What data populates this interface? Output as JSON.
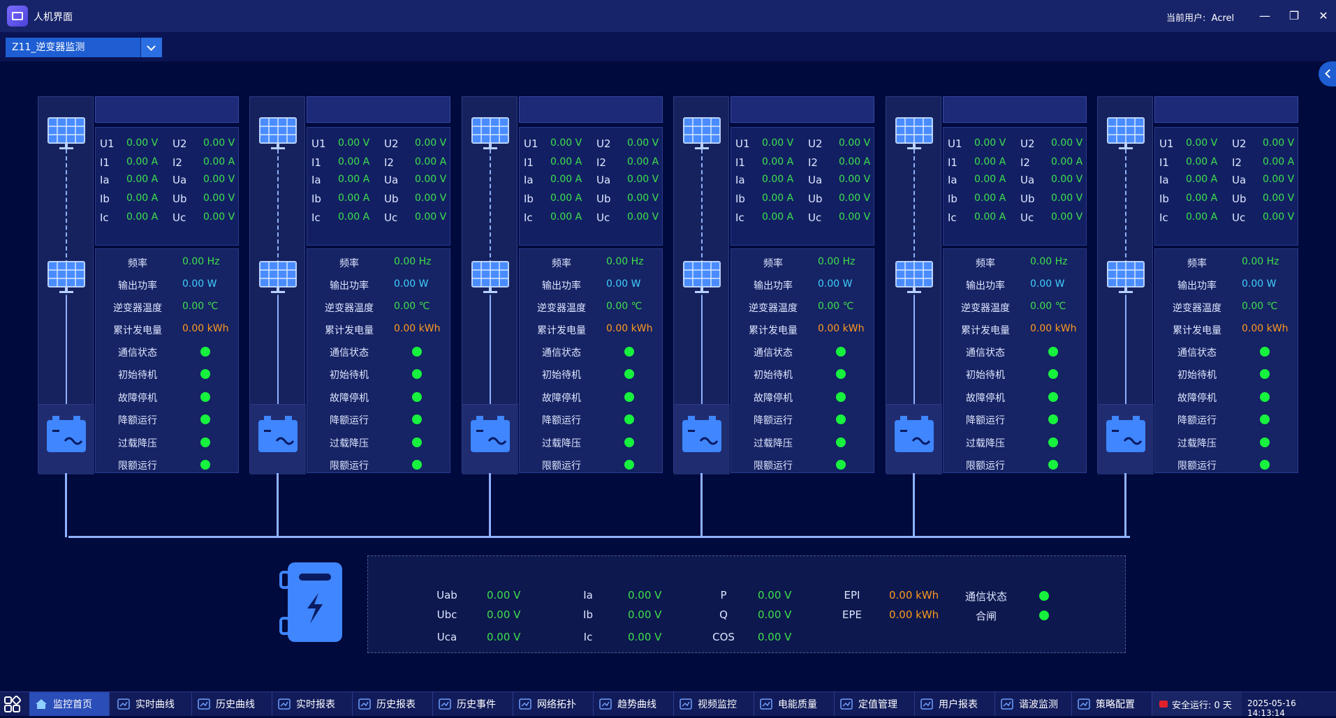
{
  "window": {
    "title": "人机界面",
    "user_label": "当前用户:",
    "user": "Acrel"
  },
  "selector": {
    "value": "Z11_逆变器监测"
  },
  "inverters": [
    {
      "U1": "0.00 V",
      "U2": "0.00 V",
      "I1": "0.00 A",
      "I2": "0.00 A",
      "Ia": "0.00 A",
      "Ua": "0.00 V",
      "Ib": "0.00 A",
      "Ub": "0.00 V",
      "Ic": "0.00 A",
      "Uc": "0.00 V",
      "freq": "0.00 Hz",
      "power": "0.00 W",
      "temp": "0.00 ℃",
      "energy": "0.00 kWh"
    },
    {
      "U1": "0.00 V",
      "U2": "0.00 V",
      "I1": "0.00 A",
      "I2": "0.00 A",
      "Ia": "0.00 A",
      "Ua": "0.00 V",
      "Ib": "0.00 A",
      "Ub": "0.00 V",
      "Ic": "0.00 A",
      "Uc": "0.00 V",
      "freq": "0.00 Hz",
      "power": "0.00 W",
      "temp": "0.00 ℃",
      "energy": "0.00 kWh"
    },
    {
      "U1": "0.00 V",
      "U2": "0.00 V",
      "I1": "0.00 A",
      "I2": "0.00 A",
      "Ia": "0.00 A",
      "Ua": "0.00 V",
      "Ib": "0.00 A",
      "Ub": "0.00 V",
      "Ic": "0.00 A",
      "Uc": "0.00 V",
      "freq": "0.00 Hz",
      "power": "0.00 W",
      "temp": "0.00 ℃",
      "energy": "0.00 kWh"
    },
    {
      "U1": "0.00 V",
      "U2": "0.00 V",
      "I1": "0.00 A",
      "I2": "0.00 A",
      "Ia": "0.00 A",
      "Ua": "0.00 V",
      "Ib": "0.00 A",
      "Ub": "0.00 V",
      "Ic": "0.00 A",
      "Uc": "0.00 V",
      "freq": "0.00 Hz",
      "power": "0.00 W",
      "temp": "0.00 ℃",
      "energy": "0.00 kWh"
    },
    {
      "U1": "0.00 V",
      "U2": "0.00 V",
      "I1": "0.00 A",
      "I2": "0.00 A",
      "Ia": "0.00 A",
      "Ua": "0.00 V",
      "Ib": "0.00 A",
      "Ub": "0.00 V",
      "Ic": "0.00 A",
      "Uc": "0.00 V",
      "freq": "0.00 Hz",
      "power": "0.00 W",
      "temp": "0.00 ℃",
      "energy": "0.00 kWh"
    },
    {
      "U1": "0.00 V",
      "U2": "0.00 V",
      "I1": "0.00 A",
      "I2": "0.00 A",
      "Ia": "0.00 A",
      "Ua": "0.00 V",
      "Ib": "0.00 A",
      "Ub": "0.00 V",
      "Ic": "0.00 A",
      "Uc": "0.00 V",
      "freq": "0.00 Hz",
      "power": "0.00 W",
      "temp": "0.00 ℃",
      "energy": "0.00 kWh"
    }
  ],
  "labels": {
    "U1": "U1",
    "U2": "U2",
    "I1": "I1",
    "I2": "I2",
    "Ia": "Ia",
    "Ua": "Ua",
    "Ib": "Ib",
    "Ub": "Ub",
    "Ic": "Ic",
    "Uc": "Uc",
    "freq": "频率",
    "power": "输出功率",
    "temp": "逆变器温度",
    "energy": "累计发电量",
    "status": [
      "通信状态",
      "初始待机",
      "故障停机",
      "降额运行",
      "过载降压",
      "限额运行"
    ]
  },
  "colors": {
    "value_green": "#3fe04c",
    "value_cyan": "#3fd0ff",
    "value_orange": "#ff9a1f",
    "status_on": "#17f23e",
    "background": "#010a3c"
  },
  "meter": {
    "Uab_label": "Uab",
    "Uab": "0.00 V",
    "Ubc_label": "Ubc",
    "Ubc": "0.00 V",
    "Uca_label": "Uca",
    "Uca": "0.00 V",
    "Ia_label": "Ia",
    "Ia": "0.00 V",
    "Ib_label": "Ib",
    "Ib": "0.00 V",
    "Ic_label": "Ic",
    "Ic": "0.00 V",
    "P_label": "P",
    "P": "0.00 V",
    "Q_label": "Q",
    "Q": "0.00 V",
    "COS_label": "COS",
    "COS": "0.00 V",
    "EPI_label": "EPI",
    "EPI": "0.00 kWh",
    "EPE_label": "EPE",
    "EPE": "0.00 kWh",
    "comm_label": "通信状态",
    "close_label": "合闸"
  },
  "taskbar": {
    "items": [
      "监控首页",
      "实时曲线",
      "历史曲线",
      "实时报表",
      "历史报表",
      "历史事件",
      "网络拓扑",
      "趋势曲线",
      "视频监控",
      "电能质量",
      "定值管理",
      "用户报表",
      "谐波监测",
      "策略配置"
    ],
    "safe_run": "安全运行: 0 天",
    "clock": "2025-05-16 14:13:14"
  }
}
